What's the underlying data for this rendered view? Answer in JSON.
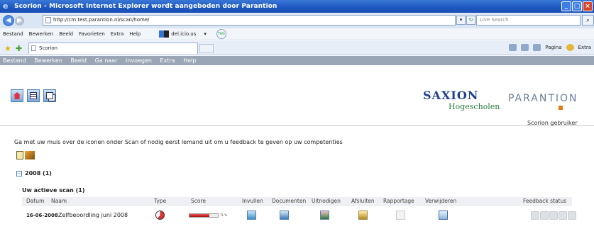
{
  "browser": {
    "title": "Scorion - Microsoft Internet Explorer wordt aangeboden door Parantion",
    "url": "http://cm.test.parantion.nl/scan/home/",
    "search_placeholder": "Live Search",
    "menu": [
      "Bestand",
      "Bewerken",
      "Beeld",
      "Favorieten",
      "Extra",
      "Help"
    ],
    "delicious": "del.icio.us",
    "tag_label": "TAG",
    "tab_title": "Scorion",
    "commands": {
      "pagina": "Pagina",
      "extra": "Extra"
    }
  },
  "app": {
    "menu": [
      "Bestand",
      "Bewerken",
      "Beeld",
      "Ga naar",
      "Invoegen",
      "Extra",
      "Help"
    ],
    "logo_saxion": "SAXION",
    "logo_saxion_sub": "Hogescholen",
    "logo_parantion": "PARANTION",
    "user_label": "Scorion gebruiker",
    "intro": "Ga met uw muis over de iconen onder Scan of nodig eerst iemand uit om u feedback te geven op uw competenties",
    "year_group": "2008 (1)",
    "active_scan_heading": "Uw actieve scan (1)",
    "columns": {
      "datum": "Datum",
      "naam": "Naam",
      "type": "Type",
      "score": "Score",
      "invullen": "Invullen",
      "documenten": "Documenten",
      "uitnodigen": "Uitnodigen",
      "afsluiten": "Afsluiten",
      "rapportage": "Rapportage",
      "verwijderen": "Verwijderen",
      "feedback_status": "Feedback status"
    },
    "rows": [
      {
        "datum": "16-06-2008",
        "naam": "Zelfbeoordling juni 2008",
        "score_fraction": 0.71,
        "score_label": "71 %"
      }
    ]
  }
}
